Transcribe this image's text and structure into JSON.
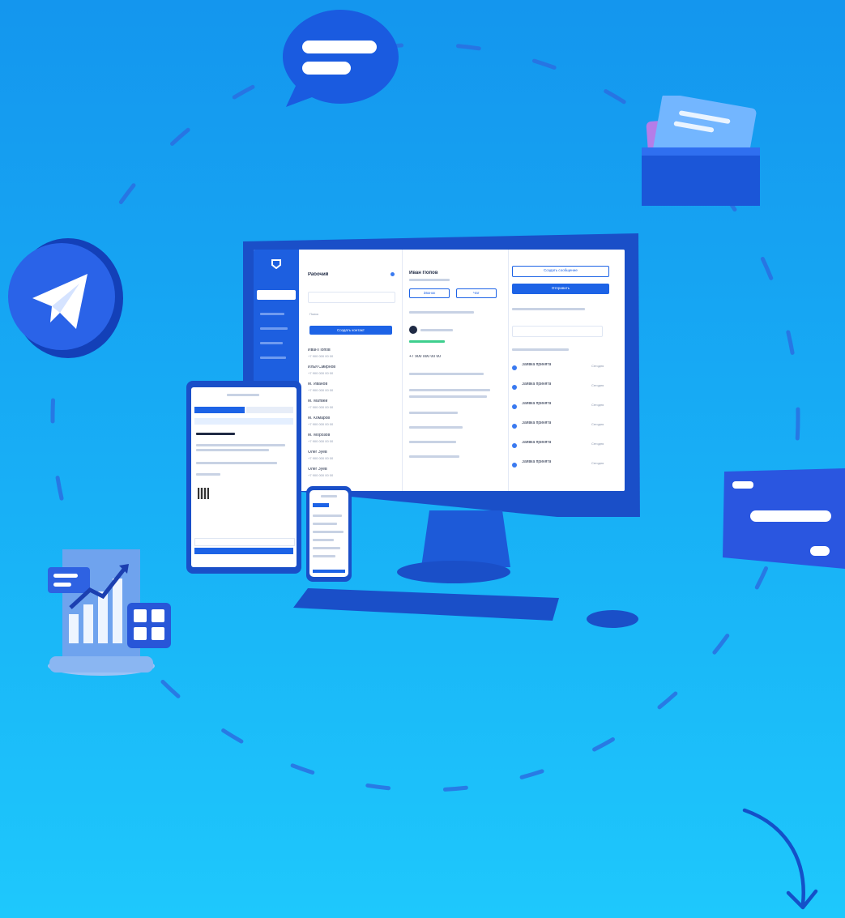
{
  "colors": {
    "background_top": "#1496ee",
    "background_bottom": "#1ec8fc",
    "device_blue": "#1a4fc8",
    "accent": "#1d63e6",
    "dashed_ring": "#2a6fe0"
  },
  "icons": {
    "chat": "chat-bubble-icon",
    "folder": "document-folder-icon",
    "telegram": "telegram-icon",
    "card": "credit-card-icon",
    "report": "report-chart-icon",
    "arrow": "curved-arrow-icon"
  },
  "screen": {
    "list_title": "Рабочий",
    "list_search_placeholder": "Поиск",
    "list_button": "Создать контакт",
    "contacts": [
      {
        "name": "Иван Попов",
        "sub": "+7 900 000 00 00"
      },
      {
        "name": "Илья Смирнов",
        "sub": "+7 900 000 00 00"
      },
      {
        "name": "М. Иванов",
        "sub": "+7 900 000 00 00"
      },
      {
        "name": "М. Матвей",
        "sub": "+7 900 000 00 00"
      },
      {
        "name": "М. Комаров",
        "sub": "+7 900 000 00 00"
      },
      {
        "name": "М. Морозов",
        "sub": "+7 900 000 00 00"
      },
      {
        "name": "Олег Зуев",
        "sub": "+7 900 000 00 00"
      },
      {
        "name": "Олег Зуев",
        "sub": "+7 900 000 00 00"
      }
    ],
    "detail_name": "Иван Попов",
    "detail_btn_1": "Звонок",
    "detail_btn_2": "Чат",
    "detail_phone": "+7 900 000 00 00",
    "right_btn_outline": "Создать сообщение",
    "right_btn_filled": "Отправить",
    "right_items": [
      {
        "title": "Заявка принята",
        "sub": "Сегодня"
      },
      {
        "title": "Заявка принята",
        "sub": "Сегодня"
      },
      {
        "title": "Заявка принята",
        "sub": "Сегодня"
      },
      {
        "title": "Заявка принята",
        "sub": "Сегодня"
      },
      {
        "title": "Заявка принята",
        "sub": "Сегодня"
      },
      {
        "title": "Заявка принята",
        "sub": "Сегодня"
      }
    ]
  }
}
